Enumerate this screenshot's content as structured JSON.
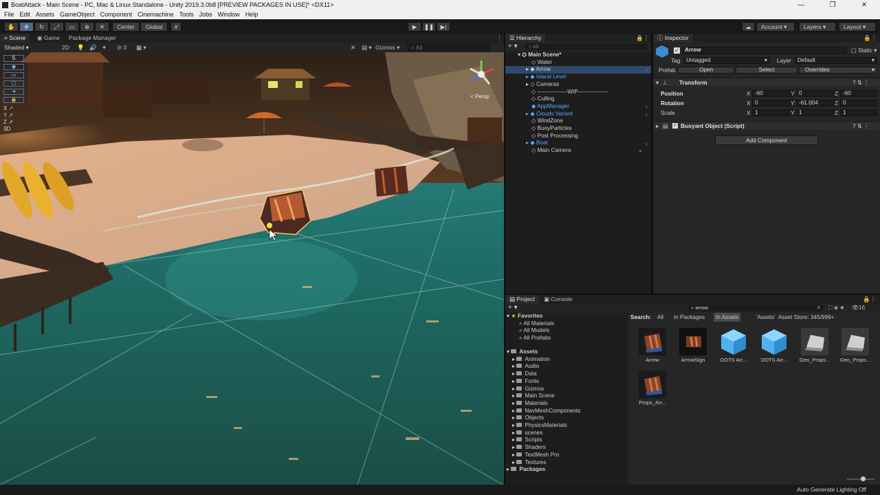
{
  "window": {
    "title": "BoatAttack - Main Scene - PC, Mac & Linux Standalone - Unity 2019.3.0b8 [PREVIEW PACKAGES IN USE]* <DX11>",
    "minimize": "—",
    "maximize": "❐",
    "close": "✕"
  },
  "menu": [
    "File",
    "Edit",
    "Assets",
    "GameObject",
    "Component",
    "Cinemachine",
    "Tools",
    "Jobs",
    "Window",
    "Help"
  ],
  "toolbar": {
    "center_label": "Center",
    "global_label": "Global",
    "account_label": "Account",
    "layers_label": "Layers",
    "layout_label": "Layout"
  },
  "scene": {
    "tabs": [
      "Scene",
      "Game",
      "Package Manager"
    ],
    "shading_mode": "Shaded",
    "mode_2d": "2D",
    "hidden_count": "0",
    "gizmos_label": "Gizmos",
    "search_placeholder": "All",
    "gizmo_view_label": "< Persp",
    "overlay_number": "5",
    "axis_labels": [
      "X",
      "Y",
      "Z",
      "3D"
    ]
  },
  "hierarchy": {
    "tab": "Hierarchy",
    "search_placeholder": "All",
    "items": [
      {
        "label": "Main Scene*",
        "type": "scene"
      },
      {
        "label": "Water",
        "type": "object"
      },
      {
        "label": "Arrow",
        "type": "object"
      },
      {
        "label": "Island Level",
        "type": "prefab"
      },
      {
        "label": "Cameras",
        "type": "object"
      },
      {
        "label": "----------------WIP----------------",
        "type": "object"
      },
      {
        "label": "Culling",
        "type": "object"
      },
      {
        "label": "AppManager",
        "type": "prefab"
      },
      {
        "label": "Clouds Variant",
        "type": "prefab"
      },
      {
        "label": "WindZone",
        "type": "object"
      },
      {
        "label": "BuoyParticles",
        "type": "object"
      },
      {
        "label": "Post Processing",
        "type": "object"
      },
      {
        "label": "Boat",
        "type": "prefab"
      },
      {
        "label": "Main Camera",
        "type": "object"
      }
    ]
  },
  "inspector": {
    "tab": "Inspector",
    "object_name": "Arrow",
    "static_label": "Static",
    "tag_label": "Tag",
    "tag_value": "Untagged",
    "layer_label": "Layer",
    "layer_value": "Default",
    "prefab_label": "Prefab",
    "open_label": "Open",
    "select_label": "Select",
    "overrides_label": "Overrides",
    "transform": {
      "title": "Transform",
      "position_label": "Position",
      "rotation_label": "Rotation",
      "scale_label": "Scale",
      "position": {
        "x": "-60",
        "y": "0",
        "z": "-60"
      },
      "rotation": {
        "x": "0",
        "y": "-61.004",
        "z": "0"
      },
      "scale": {
        "x": "1",
        "y": "1",
        "z": "1"
      }
    },
    "script_component": "Buoyant Object (Script)",
    "add_component_label": "Add Component"
  },
  "project": {
    "tabs": [
      "Project",
      "Console"
    ],
    "search_value": "arrow",
    "filter": {
      "search_label": "Search:",
      "options": [
        "All",
        "In Packages",
        "In Assets",
        "'Assets'",
        "Asset Store: 345/999+"
      ],
      "active": "In Assets"
    },
    "visible_count": "16",
    "favorites": {
      "title": "Favorites",
      "items": [
        "All Materials",
        "All Models",
        "All Prefabs"
      ]
    },
    "assets": {
      "title": "Assets",
      "folders": [
        "Animation",
        "Audio",
        "Data",
        "Fonts",
        "Gizmos",
        "Main Scene",
        "Materials",
        "NavMeshComponents",
        "Objects",
        "PhysicsMaterials",
        "scenes",
        "Scripts",
        "Shaders",
        "TextMesh Pro",
        "Textures"
      ]
    },
    "packages_label": "Packages",
    "results": [
      {
        "name": "Arrow",
        "kind": "model"
      },
      {
        "name": "ArrowSign",
        "kind": "model"
      },
      {
        "name": "DOTS Arr...",
        "kind": "prefab"
      },
      {
        "name": "DOTS Arr...",
        "kind": "prefab"
      },
      {
        "name": "Geo_Props...",
        "kind": "mesh"
      },
      {
        "name": "Geo_Props...",
        "kind": "mesh"
      },
      {
        "name": "Props_Arr...",
        "kind": "model"
      }
    ]
  },
  "status": {
    "right_text": "Auto Generate Lighting Off"
  },
  "colors": {
    "selection": "#2f4a6b",
    "prefab_text": "#58a6ff",
    "panel_dark": "#1d1d1d",
    "accent": "#4d6a8e"
  }
}
